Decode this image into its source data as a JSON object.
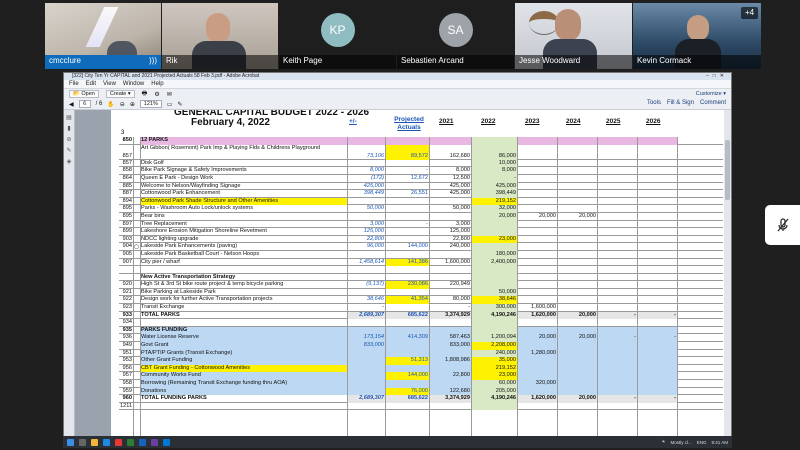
{
  "participants": [
    {
      "name": "cmcclure",
      "kind": "video",
      "status_icon": "live-audio-icon"
    },
    {
      "name": "Rik",
      "kind": "video"
    },
    {
      "name": "Keith Page",
      "kind": "avatar",
      "initials": "KP",
      "color": "#8fbcc1"
    },
    {
      "name": "Sebastien Arcand",
      "kind": "avatar",
      "initials": "SA",
      "color": "#9ea3aa"
    },
    {
      "name": "Jesse Woodward",
      "kind": "video"
    },
    {
      "name": "Kevin Cormack",
      "kind": "video"
    }
  ],
  "more_participants": "+4",
  "window": {
    "title": "[322] City Ten Yr CAPITAL and 2021 Projected Actuals 58 Feb 3.pdf - Adobe Acrobat",
    "menus": [
      "File",
      "Edit",
      "View",
      "Window",
      "Help"
    ],
    "toolbar": {
      "open": "Open",
      "create": "Create",
      "customize": "Customize"
    },
    "nav": {
      "page": "6",
      "of": "/ 6",
      "zoom": "121%",
      "tools": "Tools",
      "fill_sign": "Fill & Sign",
      "comment": "Comment"
    }
  },
  "doc": {
    "title": "GENERAL CAPITAL BUDGET 2022 - 2026",
    "date": "February 4, 2022",
    "row_label": "3",
    "headers": {
      "pm": "+/-",
      "pa": "Projected Actuals",
      "y21": "2021",
      "y22": "2022",
      "y23": "2023",
      "y24": "2024",
      "y25": "2025",
      "y26": "2026"
    }
  },
  "rows": [
    {
      "n": "850",
      "d": "12  PARKS",
      "cls": "pink bold"
    },
    {
      "n": "857",
      "d": "Art Gibbon( Rosemont) Park Imp & Playing Flds & Childrens Playground",
      "pm": "73,106",
      "pa": "89,572",
      "y21": "162,680",
      "y22": "86,000",
      "cls": "tall",
      "hpa": true
    },
    {
      "n": "857",
      "d": "Disk Golf",
      "y22": "10,000"
    },
    {
      "n": "858",
      "d": "Bike Park Signage & Safety Improvements",
      "pm": "8,000",
      "y21": "8,000",
      "y22": "8,000",
      "pa": "-"
    },
    {
      "n": "864",
      "d": "Queen E Park - Design Work",
      "pm": "(172)",
      "pa": "12,672",
      "y21": "12,500",
      "y22": "-"
    },
    {
      "n": "885",
      "d": "Welcome to Nelson/Wayfinding Signage",
      "pm": "425,000",
      "y21": "425,000",
      "y22": "425,000"
    },
    {
      "n": "887",
      "d": "Cottonwood Park Enhancement",
      "pm": "398,449",
      "pa": "26,551",
      "y21": "425,000",
      "y22": "398,449"
    },
    {
      "n": "894",
      "d": "Cottonwood Park Shade Structure and Other Amenities",
      "y22": "219,152",
      "cls": "hl",
      "h22": true
    },
    {
      "n": "895",
      "d": "Parks - Washroom Auto Lock/unlock systems",
      "pm": "50,000",
      "y21": "50,000",
      "y22": "32,000"
    },
    {
      "n": "895",
      "d": "Bear bins",
      "y22": "20,000",
      "y23": "20,000",
      "y24": "20,000"
    },
    {
      "n": "897",
      "d": "Tree Replacement",
      "pm": "3,000",
      "y21": "3,000",
      "pa": "-"
    },
    {
      "n": "899",
      "d": "Lakeshore Erosion Mitigation Shoreline Revetment",
      "pm": "125,000",
      "y21": "125,000"
    },
    {
      "n": "903",
      "d": "NDCC lighting upgrade",
      "pm": "22,800",
      "y21": "22,800",
      "y22": "23,000",
      "h22": true
    },
    {
      "n": "904",
      "d": "Lakeside Park Enhancements (paving)",
      "pm": "96,000",
      "pa": "144,000",
      "y21": "240,000",
      "icon": true
    },
    {
      "n": "905",
      "d": "Lakeside Park Basketball Court - Nelson Hoops",
      "y22": "180,000"
    },
    {
      "n": "907",
      "d": "City pier / wharf",
      "pm": "1,458,614",
      "pa": "141,386",
      "y21": "1,600,000",
      "y22": "2,400,000",
      "hpa": true
    },
    {
      "n": "",
      "d": ""
    },
    {
      "n": "",
      "d": "New Active Transportation Strategy",
      "cls": "bold"
    },
    {
      "n": "920",
      "d": "High St & 3rd St bike route project & temp bicycle parking",
      "pm": "(9,137)",
      "pa": "230,086",
      "y21": "220,949",
      "hpa": true
    },
    {
      "n": "921",
      "d": "Bike Parking at Lakeside Park",
      "y22": "50,000"
    },
    {
      "n": "922",
      "d": "Design work for further Active Transportation projects",
      "pm": "38,646",
      "pa": "41,354",
      "y21": "80,000",
      "y22": "38,646",
      "hpa": true,
      "h22": true
    },
    {
      "n": "923",
      "d": "Transit Exchange",
      "pm": "-",
      "y21": "-",
      "y22": "300,000",
      "y23": "1,600,000"
    },
    {
      "n": "933",
      "d": "TOTAL PARKS",
      "pm": "2,689,307",
      "pa": "685,622",
      "y21": "3,374,929",
      "y22": "4,190,246",
      "y23": "1,620,000",
      "y24": "20,000",
      "y25": "-",
      "y26": "-",
      "cls": "bold sep"
    },
    {
      "n": "934",
      "d": ""
    },
    {
      "n": "935",
      "d": "PARKS FUNDING",
      "cls": "blue bold"
    },
    {
      "n": "936",
      "d": "Water License Reserve",
      "pm": "173,154",
      "pa": "414,309",
      "y21": "587,463",
      "y22": "1,200,094",
      "y23": "20,000",
      "y24": "20,000",
      "y25": "-",
      "y26": "-",
      "cls": "blue"
    },
    {
      "n": "949",
      "d": "Govt Grant",
      "pm": "833,000",
      "y21": "833,000",
      "y22": "2,208,000",
      "cls": "blue",
      "h22": true
    },
    {
      "n": "951",
      "d": "PTA/PTIP Grants (Transit Exchange)",
      "y22": "240,000",
      "y23": "1,280,000",
      "cls": "blue"
    },
    {
      "n": "953",
      "d": "Other Grant Funding",
      "pa": "51,313",
      "y21": "1,808,986",
      "y22": "35,000",
      "cls": "blue",
      "hpa": true,
      "h22": true
    },
    {
      "n": "956",
      "d": "CBT Grant Funding - Cottonwood Amenities",
      "y22": "219,152",
      "cls": "blue hl",
      "h22": true
    },
    {
      "n": "957",
      "d": "Community Works Fund",
      "pa": "144,000",
      "y21": "22,800",
      "y22": "23,000",
      "cls": "blue",
      "hpa": true,
      "h22": true
    },
    {
      "n": "958",
      "d": "Borrowing (Remaining Transit Exchange funding thru AOA)",
      "y22": "60,000",
      "y23": "320,000",
      "cls": "blue"
    },
    {
      "n": "959",
      "d": "Donations",
      "pa": "76,000",
      "y21": "122,680",
      "y22": "205,000",
      "cls": "blue",
      "hpa": true
    },
    {
      "n": "960",
      "d": "TOTAL FUNDING PARKS",
      "pm": "2,689,307",
      "pa": "685,622",
      "y21": "3,374,929",
      "y22": "4,190,246",
      "y23": "1,620,000",
      "y24": "20,000",
      "y25": "-",
      "y26": "-",
      "cls": "bold sep"
    },
    {
      "n": "1211",
      "d": ""
    }
  ],
  "taskbar": {
    "weather": "Mostly cl...",
    "lang": "ENG",
    "time": "9:41 AM"
  },
  "colors": {
    "accent": "#0f6cbd",
    "highlight": "#fff200",
    "parks_header": "#e8b8e2",
    "funding": "#bcd8f2",
    "col2022": "#d9e9c5"
  }
}
